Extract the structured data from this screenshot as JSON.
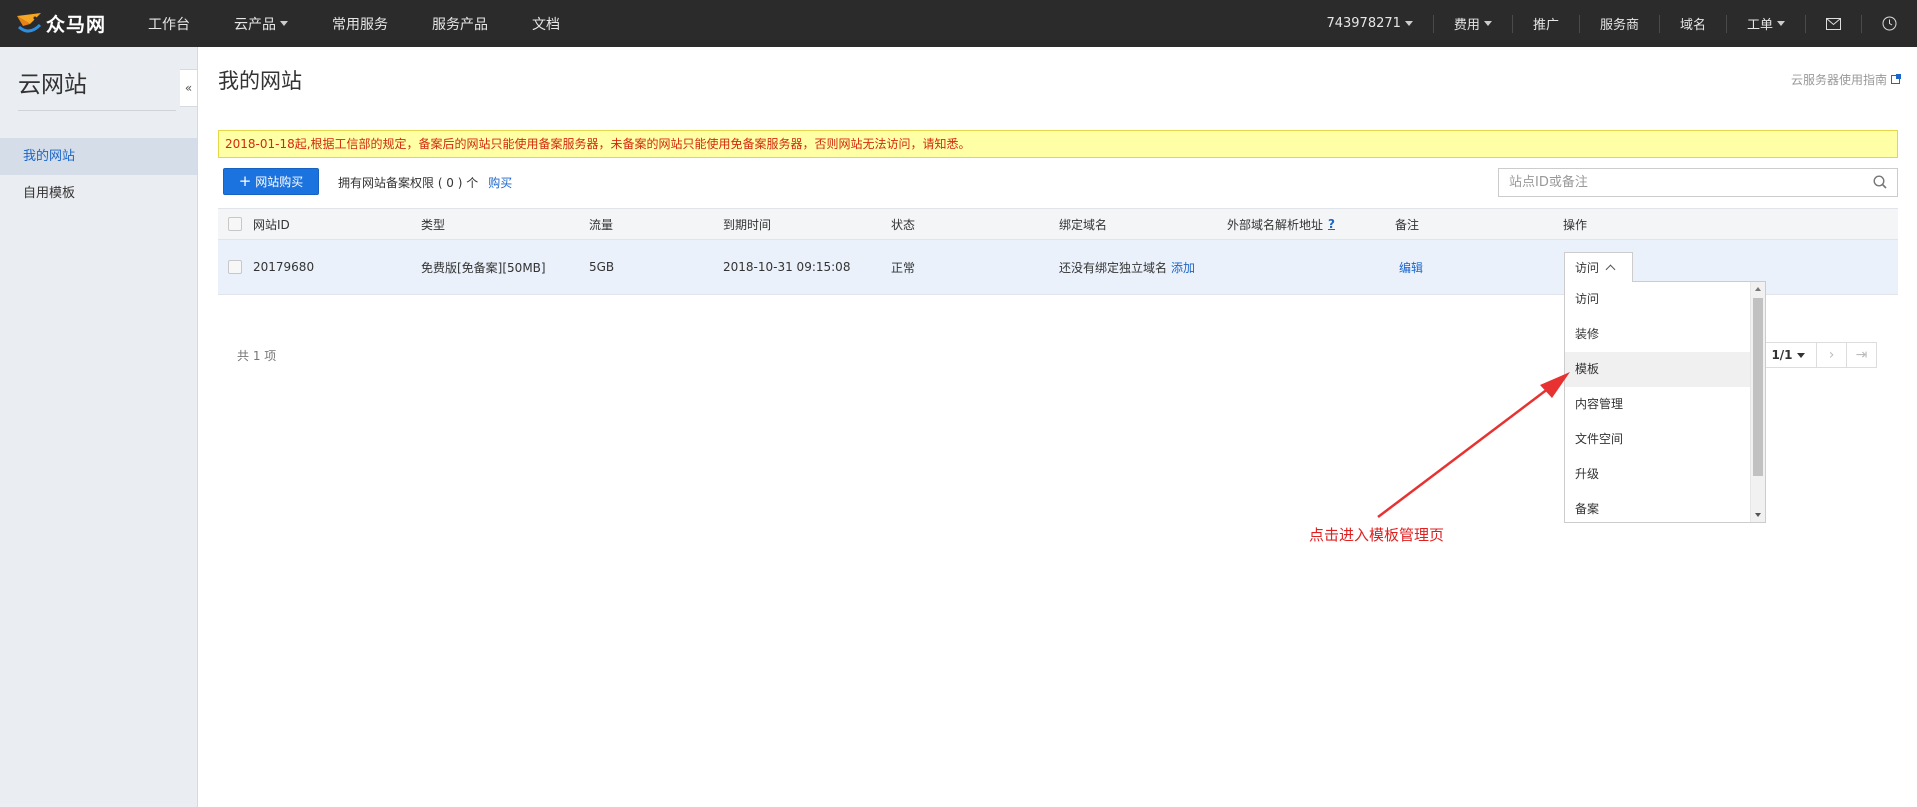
{
  "topbar": {
    "logo_text": "众马网",
    "nav": [
      {
        "label": "工作台",
        "caret": false
      },
      {
        "label": "云产品",
        "caret": true
      },
      {
        "label": "常用服务",
        "caret": false
      },
      {
        "label": "服务产品",
        "caret": false
      },
      {
        "label": "文档",
        "caret": false
      }
    ],
    "account": "743978271",
    "right_items": [
      "费用",
      "推广",
      "服务商",
      "域名",
      "工单"
    ]
  },
  "sidebar": {
    "title": "云网站",
    "items": [
      {
        "label": "我的网站",
        "active": true
      },
      {
        "label": "自用模板",
        "active": false
      }
    ]
  },
  "main": {
    "title": "我的网站",
    "guide_link": "云服务器使用指南",
    "notice": "2018-01-18起,根据工信部的规定，备案后的网站只能使用备案服务器，未备案的网站只能使用免备案服务器，否则网站无法访问，请知悉。",
    "buy_button": "网站购买",
    "quota_text": "拥有网站备案权限 ( 0 ) 个",
    "quota_link": "购买",
    "search_placeholder": "站点ID或备注",
    "table": {
      "headers": [
        "网站ID",
        "类型",
        "流量",
        "到期时间",
        "状态",
        "绑定域名",
        "外部域名解析地址",
        "备注",
        "操作"
      ],
      "help_mark": "?",
      "row": {
        "id": "20179680",
        "type": "免费版[免备案][50MB]",
        "traffic": "5GB",
        "expire": "2018-10-31 09:15:08",
        "status": "正常",
        "domain_text": "还没有绑定独立域名",
        "domain_link": "添加",
        "remark_link": "编辑"
      }
    },
    "total": "共 1 项",
    "pager": {
      "page": "1/1"
    }
  },
  "dropdown": {
    "selected": "访问",
    "options": [
      "访问",
      "装修",
      "模板",
      "内容管理",
      "文件空间",
      "升级",
      "备案"
    ],
    "hovered_index": 2
  },
  "annotation": "点击进入模板管理页",
  "colors": {
    "accent": "#1b73e0",
    "annotation": "#e02020",
    "notice_bg": "#ffffa6"
  }
}
